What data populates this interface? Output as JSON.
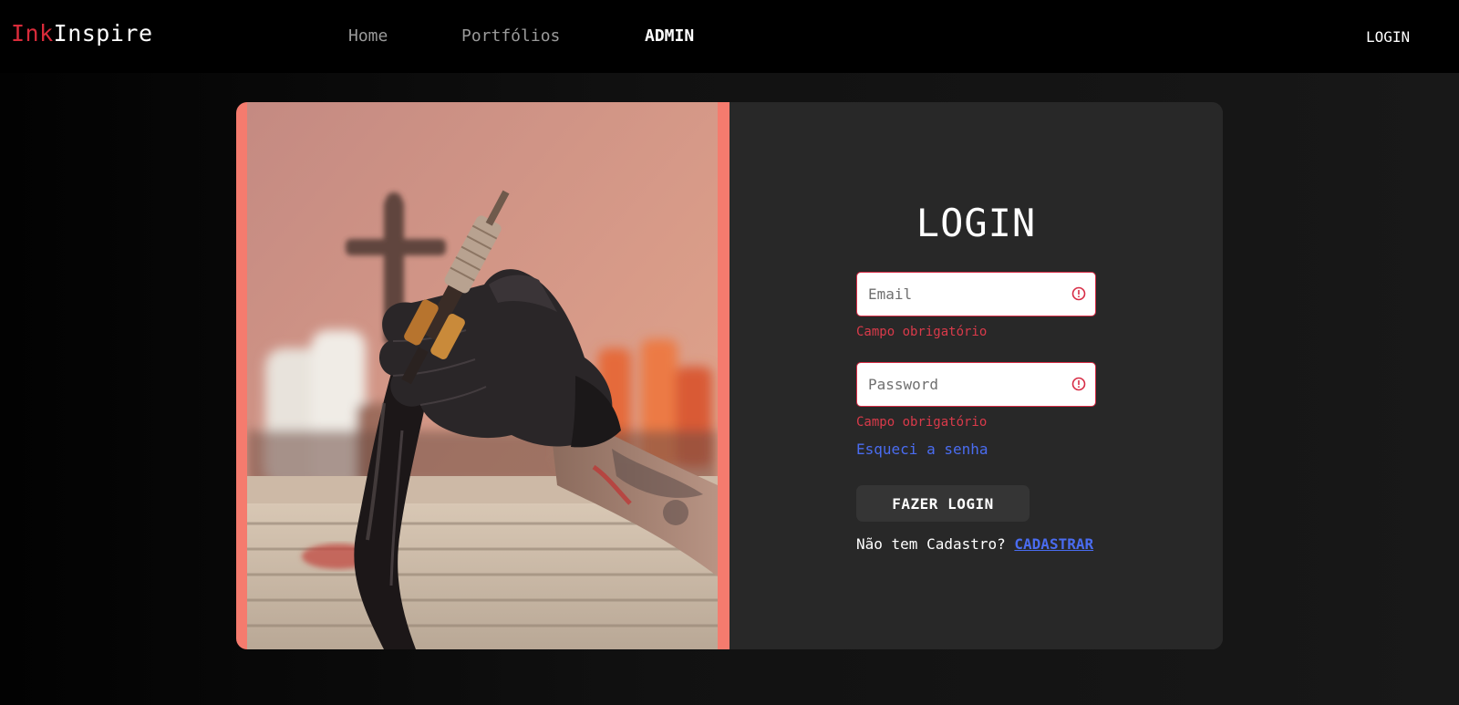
{
  "header": {
    "brand_part1": "Ink",
    "brand_part2": "Inspire",
    "nav": [
      {
        "label": "Home"
      },
      {
        "label": "Portfólios"
      },
      {
        "label": "ADMIN"
      }
    ],
    "login_label": "LOGIN"
  },
  "hero_image": {
    "subject": "tattoo-artist-holding-tattoo-machine"
  },
  "form": {
    "title": "LOGIN",
    "email": {
      "placeholder": "Email",
      "value": "",
      "error": "Campo obrigatório"
    },
    "password": {
      "placeholder": "Password",
      "value": "",
      "error": "Campo obrigatório"
    },
    "forgot_label": "Esqueci a senha",
    "submit_label": "FAZER LOGIN",
    "signup_prompt": "Não tem Cadastro?",
    "signup_link": "CADASTRAR"
  },
  "colors": {
    "brand_accent": "#d92b3a",
    "frame_accent": "#f57b6e",
    "error": "#d72c45",
    "link": "#4a6cf0",
    "panel": "#282828"
  }
}
